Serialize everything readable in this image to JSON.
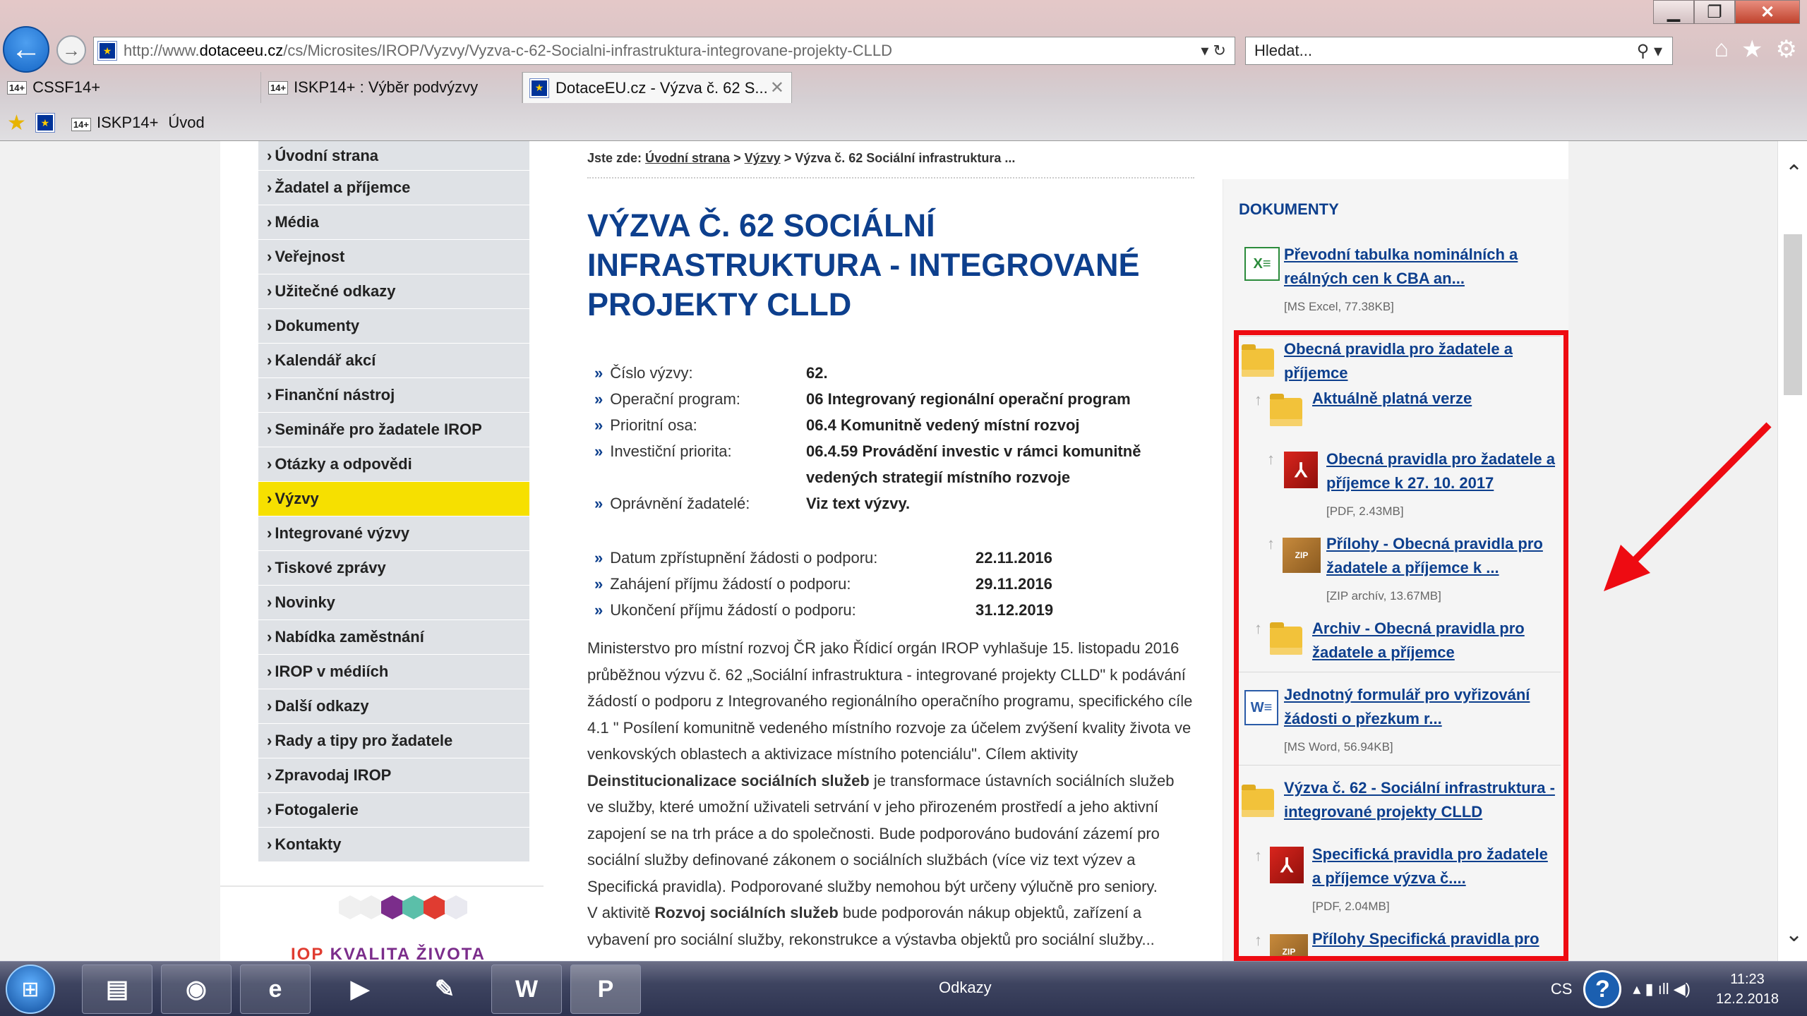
{
  "browser": {
    "url_prefix": "http://www.",
    "url_host": "dotaceeu.cz",
    "url_path": "/cs/Microsites/IROP/Vyzvy/Vyzva-c-62-Socialni-infrastruktura-integrovane-projekty-CLLD",
    "address_controls": "▾ ↻",
    "search_placeholder": "Hledat...",
    "search_controls": "⚲ ▾",
    "tabs": [
      {
        "label": "CSSF14+"
      },
      {
        "label": "ISKP14+ : Výběr podvýzvy"
      },
      {
        "label": "DotaceEU.cz - Výzva č. 62 S..."
      }
    ],
    "tab_badge": "14+",
    "favorites": [
      {
        "label": "ISKP14+"
      },
      {
        "label": "Úvod"
      }
    ],
    "window_buttons": {
      "minimize": "▁",
      "maximize": "❐",
      "close": "✕"
    },
    "tool_icons": {
      "home": "⌂",
      "favorites": "★",
      "settings": "⚙"
    }
  },
  "nav": {
    "items": [
      {
        "label": "Úvodní strana"
      },
      {
        "label": "Žadatel a příjemce"
      },
      {
        "label": "Média"
      },
      {
        "label": "Veřejnost"
      },
      {
        "label": "Užitečné odkazy"
      },
      {
        "label": "Dokumenty"
      },
      {
        "label": "Kalendář akcí"
      },
      {
        "label": "Finanční nástroj"
      },
      {
        "label": "Semináře pro žadatele IROP"
      },
      {
        "label": "Otázky a odpovědi"
      },
      {
        "label": "Výzvy",
        "active": true
      },
      {
        "label": "Integrované výzvy"
      },
      {
        "label": "Tiskové zprávy"
      },
      {
        "label": "Novinky"
      },
      {
        "label": "Nabídka zaměstnání"
      },
      {
        "label": "IROP v médiích"
      },
      {
        "label": "Další odkazy"
      },
      {
        "label": "Rady a tipy pro žadatele"
      },
      {
        "label": "Zpravodaj IROP"
      },
      {
        "label": "Fotogalerie"
      },
      {
        "label": "Kontakty"
      }
    ],
    "logo_text_red": "IOP",
    "logo_text": "KVALITA ŽIVOTA"
  },
  "breadcrumb": {
    "prefix": "Jste zde:",
    "home": "Úvodní strana",
    "sep1": ">",
    "section": "Výzvy",
    "sep2": ">",
    "current": "Výzva č. 62 Sociální infrastruktura ..."
  },
  "main": {
    "title": "Výzva č. 62 Sociální infrastruktura - integrované projekty CLLD",
    "bullet": "»",
    "info": [
      {
        "key": "Číslo výzvy:",
        "value": "62."
      },
      {
        "key": "Operační program:",
        "value": "06 Integrovaný regionální operační program"
      },
      {
        "key": "Prioritní osa:",
        "value": "06.4 Komunitně vedený místní rozvoj"
      },
      {
        "key": "Investiční priorita:",
        "value": "06.4.59 Provádění investic v rámci komunitně vedených strategií místního rozvoje"
      },
      {
        "key": "Oprávnění žadatelé:",
        "value": "Viz text výzvy."
      }
    ],
    "dates": [
      {
        "key": "Datum zpřístupnění žádosti o podporu:",
        "value": "22.11.2016"
      },
      {
        "key": "Zahájení příjmu žádostí o podporu:",
        "value": "29.11.2016"
      },
      {
        "key": "Ukončení příjmu žádostí o podporu:",
        "value": "31.12.2019"
      }
    ],
    "desc1": "Ministerstvo pro místní rozvoj ČR jako Řídicí orgán IROP vyhlašuje 15. listopadu 2016 průběžnou výzvu č. 62 „Sociální infrastruktura - integrované projekty CLLD\" k podávání žádostí o podporu z Integrovaného regionálního operačního programu, specifického cíle 4.1 \" Posílení komunitně vedeného místního rozvoje za účelem zvýšení kvality života ve venkovských oblastech a aktivizace místního potenciálu\". Cílem aktivity ",
    "desc1_bold": "Deinstitucionalizace sociálních služeb",
    "desc1_end": " je transformace ústavních sociálních služeb ve služby, které umožní uživateli setrvání v jeho přirozeném prostředí a jeho aktivní zapojení se na trh práce a do společnosti. Bude podporováno budování zázemí pro sociální služby definované zákonem o sociálních službách (více viz text výzev a Specifická pravidla). Podporované služby nemohou být určeny výlučně pro seniory.",
    "desc2_start": "V aktivitě ",
    "desc2_bold": "Rozvoj sociálních služeb",
    "desc2_end": " bude podporován nákup objektů, zařízení a vybavení pro sociální služby, rekonstrukce a výstavba objektů pro sociální služby..."
  },
  "sidebar": {
    "title": "DOKUMENTY",
    "docs": [
      {
        "label": "Převodní tabulka nominálních a reálných cen k CBA an...",
        "meta": "[MS Excel, 77.38KB]",
        "icon": "excel-icon"
      },
      {
        "label": "Obecná pravidla pro žadatele a příjemce",
        "icon": "folder-icon"
      },
      {
        "label": "Aktuálně platná verze",
        "icon": "folder-icon"
      },
      {
        "label": "Obecná pravidla pro žadatele a příjemce k 27. 10. 2017",
        "meta": "[PDF, 2.43MB]",
        "icon": "pdf-icon"
      },
      {
        "label": "Přílohy - Obecná pravidla pro žadatele a příjemce k ...",
        "meta": "[ZIP archív, 13.67MB]",
        "icon": "zip-icon"
      },
      {
        "label": "Archiv - Obecná pravidla pro žadatele a příjemce",
        "icon": "folder-icon"
      },
      {
        "label": "Jednotný formulář pro vyřizování žádosti o přezkum r...",
        "meta": "[MS Word, 56.94KB]",
        "icon": "word-icon"
      },
      {
        "label": "Výzva č. 62 - Sociální infrastruktura - integrované projekty CLLD",
        "icon": "folder-icon"
      },
      {
        "label": "Specifická pravidla pro žadatele a příjemce  výzva č....",
        "meta": "[PDF, 2.04MB]",
        "icon": "pdf-icon"
      },
      {
        "label": "Přílohy  Specifická pravidla pro žadatele a příjemce",
        "icon": "zip-icon"
      }
    ],
    "icon_text": {
      "excel": "X≡",
      "word": "W≡",
      "pdf": "⅄",
      "zip": "ZIP",
      "tick": "↑"
    }
  },
  "annotation": {
    "color": "#ee0b12"
  },
  "taskbar": {
    "start_icon": "⊞",
    "apps": [
      {
        "name": "explorer",
        "glyph": "▤"
      },
      {
        "name": "chrome",
        "glyph": "◉"
      },
      {
        "name": "internet-explorer",
        "glyph": "e"
      },
      {
        "name": "media-player",
        "glyph": "▶"
      },
      {
        "name": "paint",
        "glyph": "✎"
      },
      {
        "name": "word",
        "glyph": "W"
      },
      {
        "name": "powerpoint",
        "glyph": "P"
      }
    ],
    "odkazy": "Odkazy",
    "lang": "CS",
    "help": "?",
    "tray_icons": "▴  ▮  ıll  ◀)",
    "time": "11:23",
    "date": "12.2.2018"
  }
}
